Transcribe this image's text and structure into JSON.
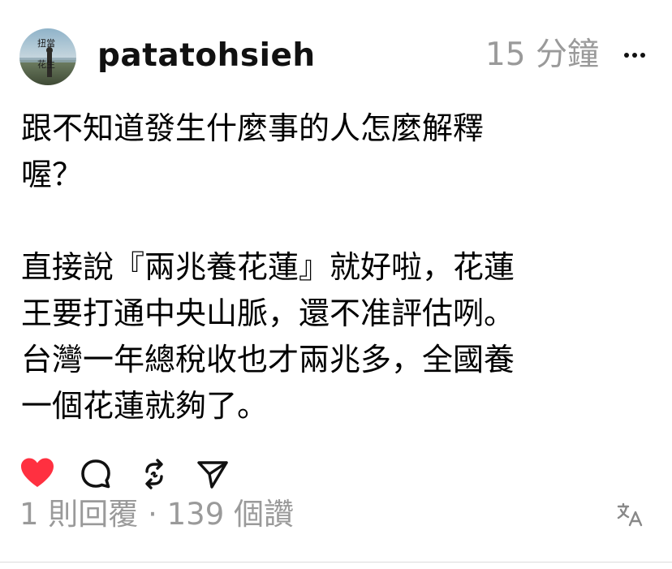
{
  "post": {
    "avatar_text": [
      "扭當",
      "花生"
    ],
    "username": "patatohsieh",
    "timestamp": "15 分鐘",
    "more_icon": "ellipsis-icon",
    "body": "跟不知道發生什麼事的人怎麼解釋\n喔？\n\n直接說『兩兆養花蓮』就好啦，花蓮\n王要打通中央山脈，還不准評估咧。\n台灣一年總稅收也才兩兆多，全國養\n一個花蓮就夠了。",
    "actions": {
      "like_icon": "heart-icon",
      "liked": true,
      "like_color": "#ff3040",
      "reply_icon": "comment-icon",
      "repost_icon": "repost-icon",
      "share_icon": "send-icon"
    },
    "replies": "1 則回覆",
    "separator": "·",
    "likes": "139 個讚",
    "translate_icon": "translate-icon"
  },
  "colors": {
    "text": "#000000",
    "muted": "#9a9a9a",
    "like": "#ff3040",
    "divider": "#dbdbdb"
  }
}
